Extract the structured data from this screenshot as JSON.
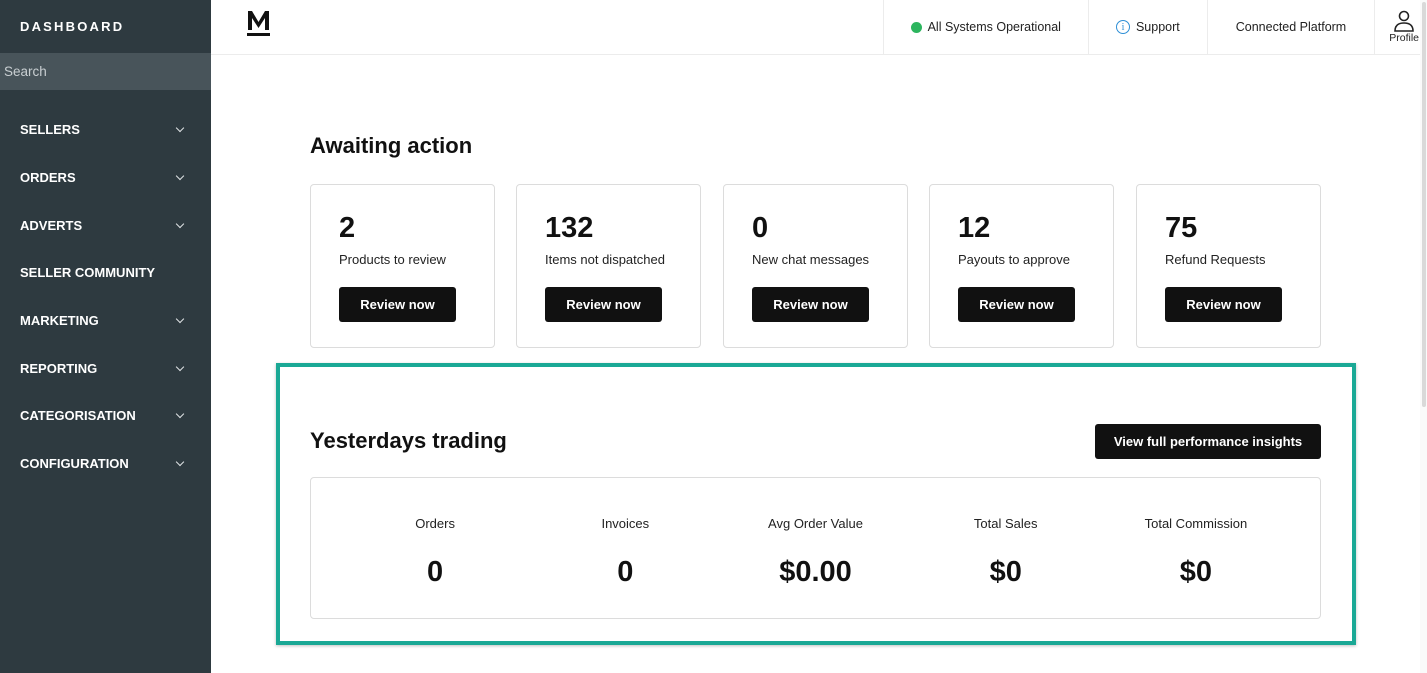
{
  "sidebar": {
    "title": "DASHBOARD",
    "search_placeholder": "Search",
    "items": [
      {
        "label": "SELLERS",
        "has_chevron": true
      },
      {
        "label": "ORDERS",
        "has_chevron": true
      },
      {
        "label": "ADVERTS",
        "has_chevron": true
      },
      {
        "label": "SELLER COMMUNITY",
        "has_chevron": false
      },
      {
        "label": "MARKETING",
        "has_chevron": true
      },
      {
        "label": "REPORTING",
        "has_chevron": true
      },
      {
        "label": "CATEGORISATION",
        "has_chevron": true
      },
      {
        "label": "CONFIGURATION",
        "has_chevron": true
      }
    ]
  },
  "topbar": {
    "logo_icon": "m-logo-icon",
    "status": "All Systems Operational",
    "status_color": "#2cb55e",
    "support": "Support",
    "connected": "Connected Platform",
    "profile": "Profile"
  },
  "awaiting": {
    "title": "Awaiting action",
    "cards": [
      {
        "count": "2",
        "label": "Products to review",
        "button": "Review now"
      },
      {
        "count": "132",
        "label": "Items not dispatched",
        "button": "Review now"
      },
      {
        "count": "0",
        "label": "New chat messages",
        "button": "Review now"
      },
      {
        "count": "12",
        "label": "Payouts to approve",
        "button": "Review now"
      },
      {
        "count": "75",
        "label": "Refund Requests",
        "button": "Review now"
      }
    ]
  },
  "trading": {
    "title": "Yesterdays trading",
    "button": "View full performance insights",
    "highlight_color": "#1aa895",
    "stats": [
      {
        "label": "Orders",
        "value": "0"
      },
      {
        "label": "Invoices",
        "value": "0"
      },
      {
        "label": "Avg Order Value",
        "value": "$0.00"
      },
      {
        "label": "Total Sales",
        "value": "$0"
      },
      {
        "label": "Total Commission",
        "value": "$0"
      }
    ]
  }
}
